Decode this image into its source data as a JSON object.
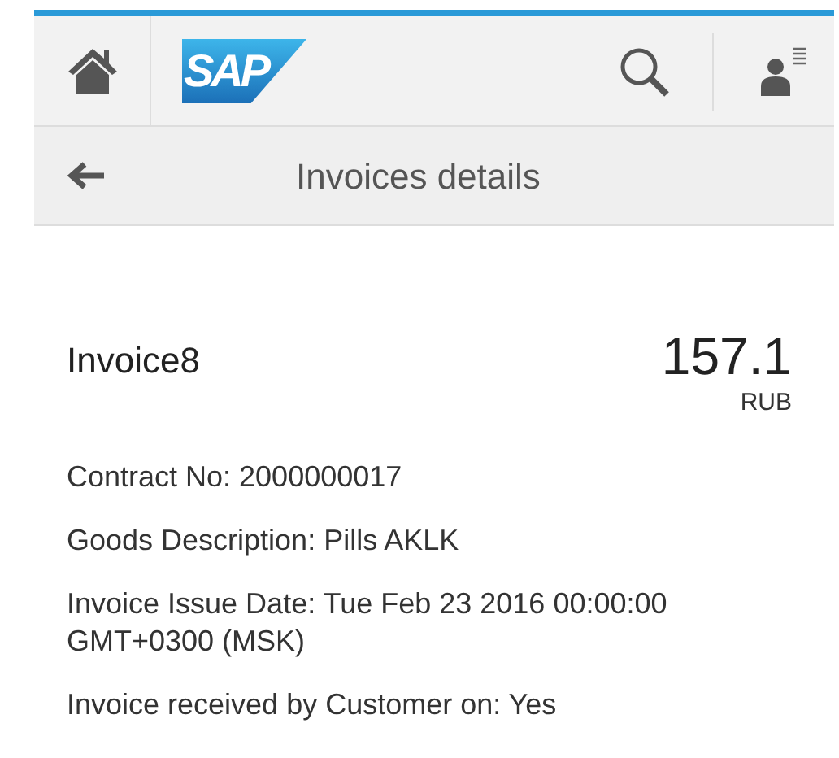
{
  "header": {
    "logo": "SAP"
  },
  "nav": {
    "title": "Invoices details"
  },
  "invoice": {
    "name": "Invoice8",
    "amount": "157.1",
    "currency": "RUB"
  },
  "fields": [
    {
      "text": "Contract No: 2000000017"
    },
    {
      "text": "Goods Description: Pills AKLK"
    },
    {
      "text": "Invoice Issue Date: Tue Feb 23 2016 00:00:00 GMT+0300 (MSK)"
    },
    {
      "text": "Invoice received by Customer on: Yes"
    }
  ]
}
